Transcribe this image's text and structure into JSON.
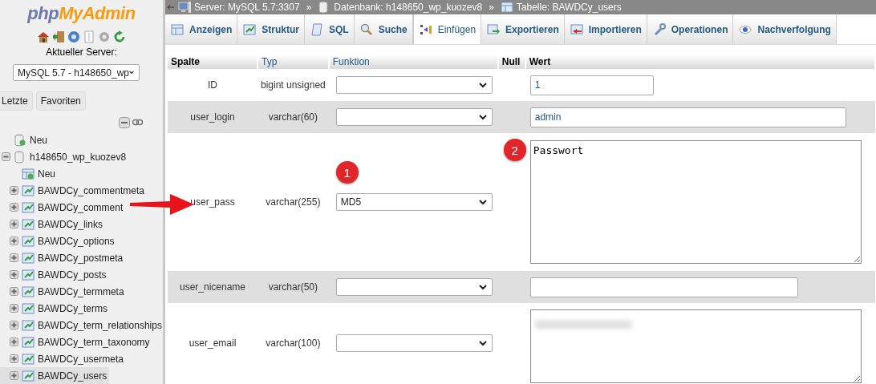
{
  "sidebar": {
    "logo": {
      "part1": "php",
      "part2": "MyAdmin"
    },
    "server_label": "Aktueller Server:",
    "server_select": {
      "value": "MySQL 5.7 - h148650_wp"
    },
    "buttons": [
      {
        "label": "Letzte"
      },
      {
        "label": "Favoriten"
      }
    ],
    "tree": [
      {
        "label": "Neu",
        "kind": "new"
      },
      {
        "label": "h148650_wp_kuozev8",
        "kind": "database",
        "expanded": true,
        "children": [
          {
            "label": "Neu",
            "kind": "new-table"
          },
          {
            "label": "BAWDCy_commentmeta",
            "kind": "table",
            "selected": false
          },
          {
            "label": "BAWDCy_comment",
            "kind": "table",
            "selected": false
          },
          {
            "label": "BAWDCy_links",
            "kind": "table",
            "selected": false
          },
          {
            "label": "BAWDCy_options",
            "kind": "table",
            "selected": false
          },
          {
            "label": "BAWDCy_postmeta",
            "kind": "table",
            "selected": false
          },
          {
            "label": "BAWDCy_posts",
            "kind": "table",
            "selected": false
          },
          {
            "label": "BAWDCy_termmeta",
            "kind": "table",
            "selected": false
          },
          {
            "label": "BAWDCy_terms",
            "kind": "table",
            "selected": false
          },
          {
            "label": "BAWDCy_term_relationships",
            "kind": "table",
            "selected": false
          },
          {
            "label": "BAWDCy_term_taxonomy",
            "kind": "table",
            "selected": false
          },
          {
            "label": "BAWDCy_usermeta",
            "kind": "table",
            "selected": false
          },
          {
            "label": "BAWDCy_users",
            "kind": "table",
            "selected": true
          }
        ]
      }
    ]
  },
  "breadcrumb": [
    {
      "kind": "server",
      "label": "Server: MySQL 5.7:3307"
    },
    {
      "kind": "database",
      "label": "Datenbank: h148650_wp_kuozev8"
    },
    {
      "kind": "table",
      "label": "Tabelle: BAWDCy_users"
    }
  ],
  "breadcrumb_separator": "»",
  "tabs": [
    {
      "label": "Anzeigen",
      "kind": "browse",
      "selected": false
    },
    {
      "label": "Struktur",
      "kind": "structure",
      "selected": false
    },
    {
      "label": "SQL",
      "kind": "sql",
      "selected": false
    },
    {
      "label": "Suche",
      "kind": "search",
      "selected": false
    },
    {
      "label": "Einfügen",
      "kind": "insert",
      "selected": true
    },
    {
      "label": "Exportieren",
      "kind": "export",
      "selected": false
    },
    {
      "label": "Importieren",
      "kind": "import",
      "selected": false
    },
    {
      "label": "Operationen",
      "kind": "operations",
      "selected": false
    },
    {
      "label": "Nachverfolgung",
      "kind": "tracking",
      "selected": false
    }
  ],
  "table": {
    "columns": [
      {
        "label": "Spalte",
        "kind": "plain"
      },
      {
        "label": "Typ",
        "kind": "link"
      },
      {
        "label": "Funktion",
        "kind": "link"
      },
      {
        "label": "Null",
        "kind": "plain"
      },
      {
        "label": "Wert",
        "kind": "plain"
      }
    ],
    "rows": [
      {
        "column": "ID",
        "type": "bigint unsigned",
        "function": "",
        "value": "1",
        "kind": "short-input"
      },
      {
        "column": "user_login",
        "type": "varchar(60)",
        "function": "",
        "value": "admin",
        "kind": "long-input"
      },
      {
        "column": "user_pass",
        "type": "varchar(255)",
        "function": "MD5",
        "value": "Passwort",
        "kind": "textarea",
        "badge_function": "1",
        "badge_value": "2"
      },
      {
        "column": "user_nicename",
        "type": "varchar(50)",
        "function": "",
        "value": "",
        "kind": "medium-input"
      },
      {
        "column": "user_email",
        "type": "varchar(100)",
        "function": "",
        "value": "",
        "kind": "textarea",
        "blurred": true
      }
    ]
  }
}
